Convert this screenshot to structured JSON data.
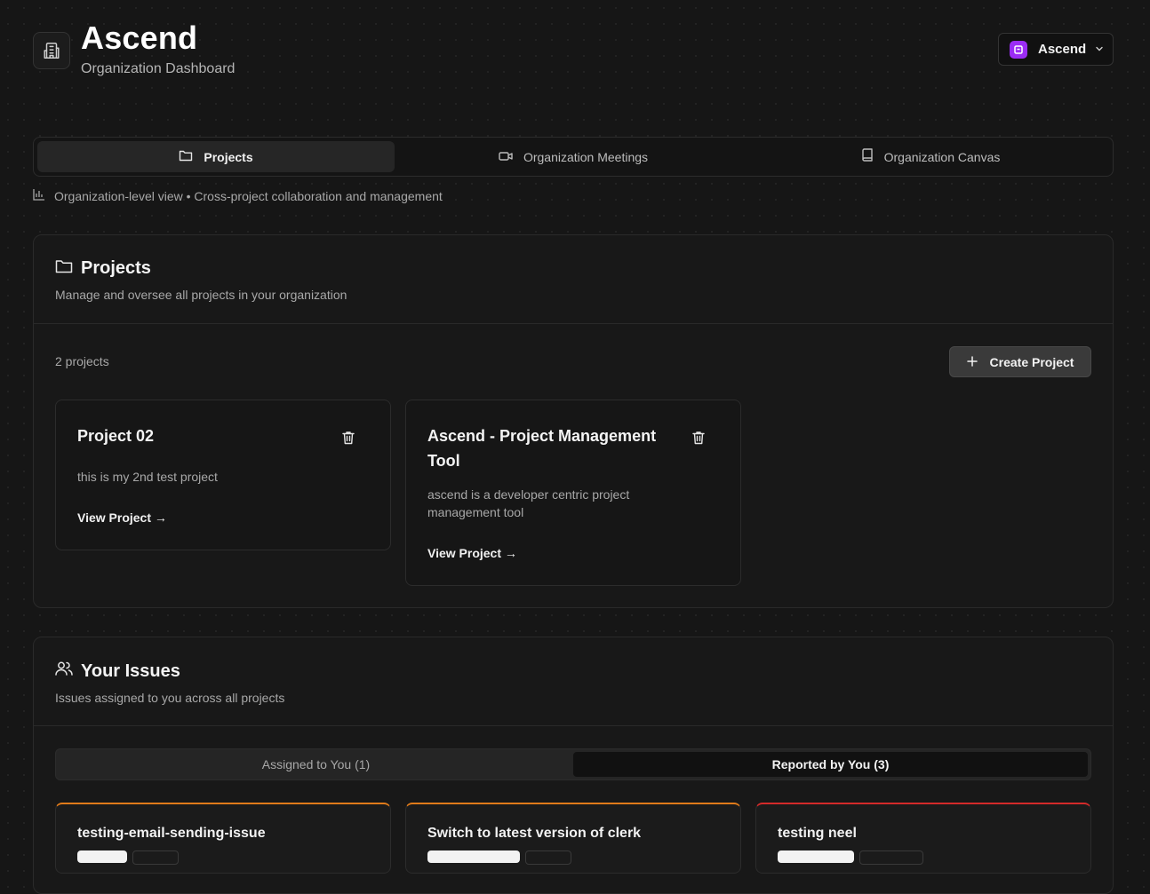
{
  "app": {
    "title": "Ascend",
    "subtitle": "Organization Dashboard"
  },
  "org_switcher": {
    "name": "Ascend",
    "badge_color": "#9b2cf5"
  },
  "tabs": [
    {
      "label": "Projects",
      "icon": "folder-icon",
      "active": true
    },
    {
      "label": "Organization Meetings",
      "icon": "video-icon",
      "active": false
    },
    {
      "label": "Organization Canvas",
      "icon": "book-icon",
      "active": false
    }
  ],
  "view_note": "Organization-level view • Cross-project collaboration and management",
  "projects_panel": {
    "title": "Projects",
    "description": "Manage and oversee all projects in your organization",
    "count_label": "2 projects",
    "create_label": "Create Project",
    "projects": [
      {
        "name": "Project 02",
        "description": "this is my 2nd test project",
        "link": "View Project →"
      },
      {
        "name": "Ascend - Project Management Tool",
        "description": "ascend is a developer centric project management tool",
        "link": "View Project →"
      }
    ]
  },
  "issues_panel": {
    "title": "Your Issues",
    "description": "Issues assigned to you across all projects",
    "tabs": [
      {
        "label": "Assigned to You (1)",
        "active": false
      },
      {
        "label": "Reported by You (3)",
        "active": true
      }
    ],
    "issues": [
      {
        "title": "testing-email-sending-issue",
        "accent": "#e07b1a"
      },
      {
        "title": "Switch to latest version of clerk",
        "accent": "#e07b1a"
      },
      {
        "title": "testing neel",
        "accent": "#d42a2a"
      }
    ]
  },
  "colors": {
    "background": "#161616",
    "panel": "#181818",
    "accent_orange": "#e07b1a",
    "accent_red": "#d42a2a"
  }
}
